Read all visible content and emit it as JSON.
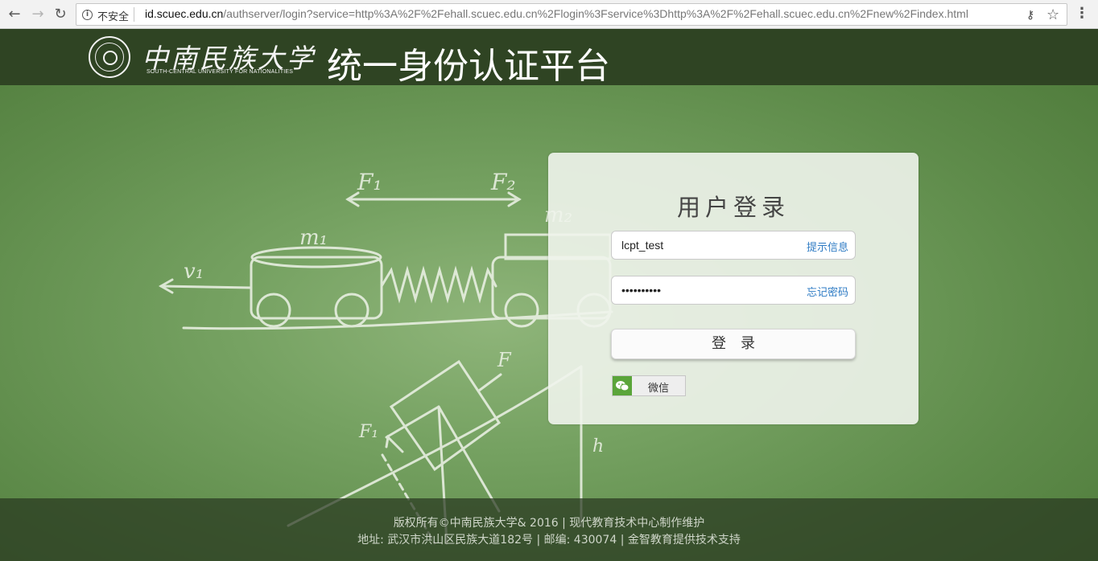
{
  "browser": {
    "security_label": "不安全",
    "url_host": "id.scuec.edu.cn",
    "url_path": "/authserver/login?service=http%3A%2F%2Fehall.scuec.edu.cn%2Flogin%3Fservice%3Dhttp%3A%2F%2Fehall.scuec.edu.cn%2Fnew%2Findex.html"
  },
  "header": {
    "university_name_cn": "中南民族大学",
    "university_name_en": "SOUTH-CENTRAL UNIVERSITY FOR NATIONALITIES",
    "platform_title": "统一身份认证平台"
  },
  "login": {
    "title": "用户登录",
    "username_value": "lcpt_test",
    "username_link": "提示信息",
    "password_value": "••••••••••",
    "password_link": "忘记密码",
    "submit_label": "登录",
    "wechat_label": "微信"
  },
  "footer": {
    "line1": "版权所有©中南民族大学& 2016 | 现代教育技术中心制作维护",
    "line2": "地址: 武汉市洪山区民族大道182号 | 邮编: 430074 | 金智教育提供技术支持"
  },
  "colors": {
    "header_band": "#2f4423",
    "accent_link": "#2e7bc4",
    "wechat_green": "#5aa53a"
  }
}
